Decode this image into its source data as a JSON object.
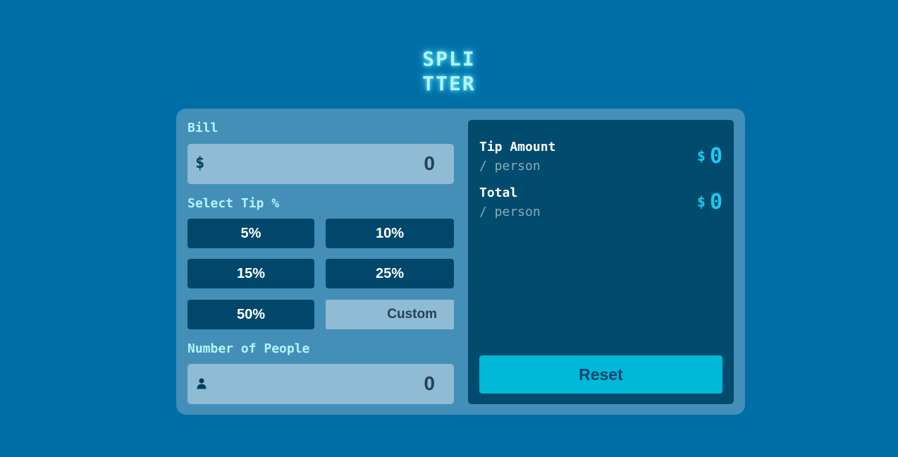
{
  "app": {
    "logo_line1": "SPLI",
    "logo_line2": "TTER"
  },
  "bill": {
    "label": "Bill",
    "currency_prefix": "$",
    "value": "0"
  },
  "tip": {
    "label": "Select Tip %",
    "options": [
      "5%",
      "10%",
      "15%",
      "25%",
      "50%"
    ],
    "custom_label": "Custom"
  },
  "people": {
    "label": "Number of People",
    "icon": "person-icon",
    "value": "0"
  },
  "results": {
    "tip_amount": {
      "title": "Tip Amount",
      "sub": "/ person",
      "currency": "$",
      "value": "0"
    },
    "total": {
      "title": "Total",
      "sub": "/ person",
      "currency": "$",
      "value": "0"
    },
    "reset_label": "Reset"
  },
  "colors": {
    "page_background": "#006ea6",
    "card_background": "#438fb8",
    "input_background": "#8fbbd4",
    "button_background": "#00476b",
    "result_panel_background": "#004b6e",
    "accent": "#00b8d8",
    "label_text": "#b7f3fb"
  }
}
